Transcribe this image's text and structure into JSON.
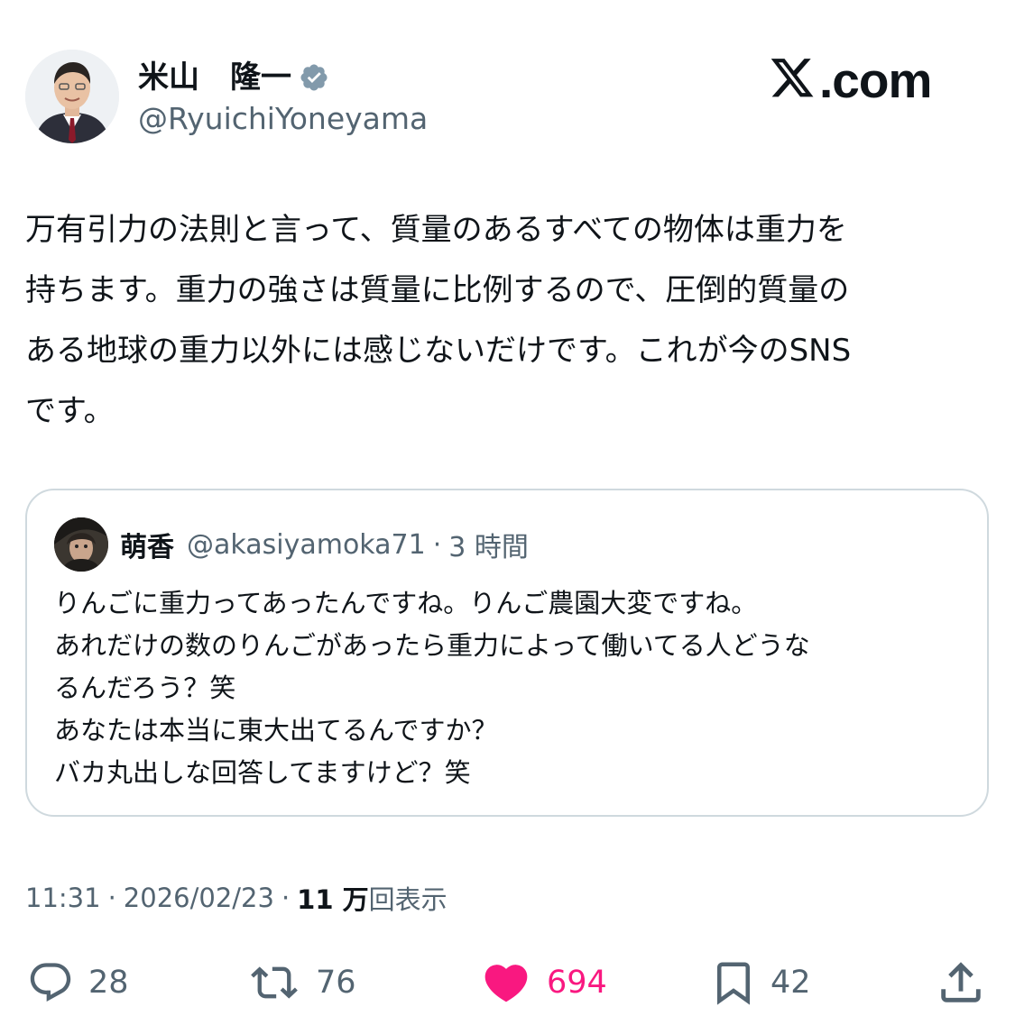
{
  "header": {
    "display_name": "米山　隆一",
    "handle": "@RyuichiYoneyama",
    "brand": ".com"
  },
  "tweet": {
    "text": "万有引力の法則と言って、質量のあるすべての物体は重力を\n持ちます。重力の強さは質量に比例するので、圧倒的質量の\nある地球の重力以外には感じないだけです。これが今のSNS\nです。"
  },
  "quote": {
    "name": "萌香",
    "handle": "@akasiyamoka71",
    "dot": "·",
    "time": "3 時間",
    "text": "りんごに重力ってあったんですね。りんご農園大変ですね。\nあれだけの数のりんごがあったら重力によって働いてる人どうな\nるんだろう？笑\nあなたは本当に東大出てるんですか？\nバカ丸出しな回答してますけど？笑"
  },
  "meta": {
    "time": "11:31",
    "dot1": "·",
    "date": "2026/02/23",
    "dot2": "·",
    "views_count": "11 万",
    "views_label": "回表示"
  },
  "actions": {
    "replies": "28",
    "reposts": "76",
    "likes": "694",
    "bookmarks": "42"
  },
  "colors": {
    "text": "#0f1419",
    "secondary": "#536471",
    "like": "#f91880",
    "border": "#cfd9de"
  }
}
